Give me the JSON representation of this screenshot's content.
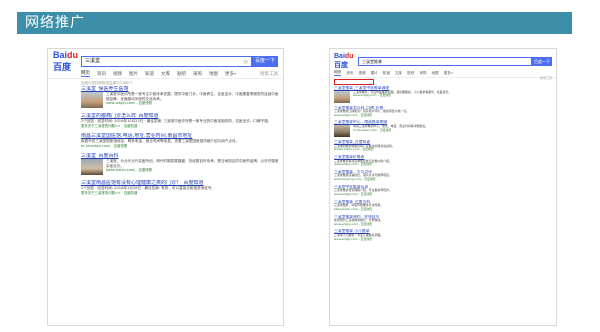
{
  "slide_title": "网络推广",
  "left": {
    "logo": {
      "a": "Bai",
      "b": "du",
      "c": "百度"
    },
    "query": "三溪堂",
    "search_button": "百度一下",
    "tabs": [
      "网页",
      "资讯",
      "视频",
      "图片",
      "知道",
      "文库",
      "贴吧",
      "采购",
      "地图",
      "更多»"
    ],
    "tool": "搜索工具",
    "result_info": "百度为您找到相关结果约3,860个",
    "results": [
      {
        "title": "三溪堂_保医养生医馆",
        "desc": "三溪堂中医诊所是一家专注中医传承发展，提供中医门诊、中医养生、名医坐诊、中医康复等服务的连锁中医馆品牌，全面推动中医药文化传承。",
        "url": "www.sxtgzy.com/ - 百度快照"
      },
      {
        "title": "三溪堂的腹痛门诊怎么样_百度知道",
        "desc": "2个回答 · 回答时间: 2016年10月23日 · 最佳答案: 三溪堂中医诊所是一家专业的中医连锁机构，名医坐诊，口碑不错。",
        "url": "更多关于三溪堂的问题>> · 百度知道"
      },
      {
        "title": "南昌三溪堂国医馆,电话,地址,营业时间,南昌市地址",
        "desc": "南昌市的三溪堂国医馆地址、联系电话、营业时间等信息，查看三溪堂国医馆详细介绍与用户点评。",
        "url": "m.3ansdian.com/ - 百度快照"
      },
      {
        "title": "三溪堂_百度百科",
        "desc": "三溪堂，为元代元代名医所创，明代时期发展鼎盛，历经数百年传承，是当地知名的中医药品牌，以诊疗疑难杂症见长。",
        "url": "baike.baidu.com/ - 百度快照"
      },
      {
        "title": "三溪堂南昌医馆有没有心理健康之类的门诊？_百度知道",
        "desc": "2个回答 · 回答时间: 2016年1月28日 · 最佳答案: 有的，可以直接去医馆咨询挂号。",
        "url": "更多关于三溪堂的问题>> · 百度知道"
      }
    ]
  },
  "right": {
    "logo": {
      "a": "Bai",
      "b": "du",
      "c": "百度"
    },
    "query": "三溪堂推拿",
    "search_button": "百度一下",
    "tabs": [
      "网页",
      "资讯",
      "视频",
      "图片",
      "知道",
      "文库",
      "贴吧",
      "采购",
      "地图",
      "更多»"
    ],
    "side": "搜索工具",
    "results": [
      {
        "title": "三溪堂推拿_三溪堂中医推拿调理",
        "desc": "三溪堂推拿，专业中医推拿调理，颈肩腰腿痛、小儿推拿等服务，名医坐诊。",
        "url": "www.sxtgzy.com/ - 百度快照"
      },
      {
        "title": "三溪堂推拿怎么样_口碑_价格",
        "desc": "三溪堂推拿口碑如何？真实用户评价，推拿项目价格一览。",
        "url": "www.sxtgzy.com/ - 百度快照"
      },
      {
        "title": "三溪堂推拿中心 - 南昌推拿按摩",
        "desc": "南昌三溪堂推拿中心，地址、电话、营业时间等详细信息。",
        "url": "m.3ansdian.com/ - 百度快照"
      },
      {
        "title": "三溪堂推拿_百度知道",
        "desc": "三溪堂的推拿效果好吗？有做过的朋友说说吗。",
        "url": "zhidao.baidu.com/ - 百度快照"
      },
      {
        "title": "三溪堂推拿价格表",
        "desc": "三溪堂推拿各项目收费标准与套餐价格介绍。",
        "url": "www.sxtgzy.com/ - 百度快照"
      },
      {
        "title": "三溪堂推拿 - 大众点评",
        "desc": "三溪堂推拿店铺信息，用户点评与推荐项目。",
        "url": "www.dianping.com/ - 百度快照"
      },
      {
        "title": "三溪堂中医推拿培训",
        "desc": "三溪堂推拿培训课程介绍，专业推拿师培养。",
        "url": "www.sxtgzy.com/ - 百度快照"
      },
      {
        "title": "三溪堂推拿_百度百科",
        "desc": "三溪堂推拿，中医传统推拿手法传承。",
        "url": "baike.baidu.com/ - 百度快照"
      },
      {
        "title": "三溪堂推拿预约 - 在线挂号",
        "desc": "在线预约三溪堂推拿服务，方便快捷。",
        "url": "www.sxtgzy.com/ - 百度快照"
      },
      {
        "title": "三溪堂推拿 小儿推拿",
        "desc": "三溪堂小儿推拿，专业儿童推拿调理。",
        "url": "www.sxtgzy.com/ - 百度快照"
      }
    ]
  }
}
